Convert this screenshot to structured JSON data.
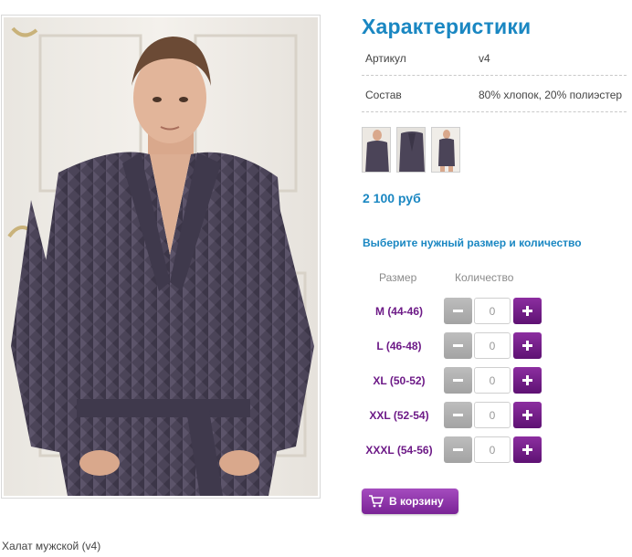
{
  "product": {
    "caption": "Халат мужской (v4)",
    "main_image_alt": "Мужчина в фиолетовом велюровом халате"
  },
  "specs": {
    "title": "Характеристики",
    "rows": [
      {
        "key": "Артикул",
        "value": "v4"
      },
      {
        "key": "Состав",
        "value": "80% хлопок, 20% полиэстер"
      }
    ]
  },
  "price": "2 100 руб",
  "order": {
    "prompt": "Выберите нужный размер и количество",
    "size_header": "Размер",
    "qty_header": "Количество",
    "sizes": [
      {
        "label": "M (44-46)",
        "qty": "0"
      },
      {
        "label": "L (46-48)",
        "qty": "0"
      },
      {
        "label": "XL (50-52)",
        "qty": "0"
      },
      {
        "label": "XXL (52-54)",
        "qty": "0"
      },
      {
        "label": "XXXL (54-56)",
        "qty": "0"
      }
    ],
    "cart_label": "В корзину"
  },
  "colors": {
    "accent_blue": "#1a87c2",
    "size_purple": "#6d1a87",
    "plus_purple": "#5e1273",
    "minus_gray": "#a3a3a3",
    "robe": "#4b4458"
  },
  "icons": [
    "minus-icon",
    "plus-icon",
    "cart-icon"
  ]
}
